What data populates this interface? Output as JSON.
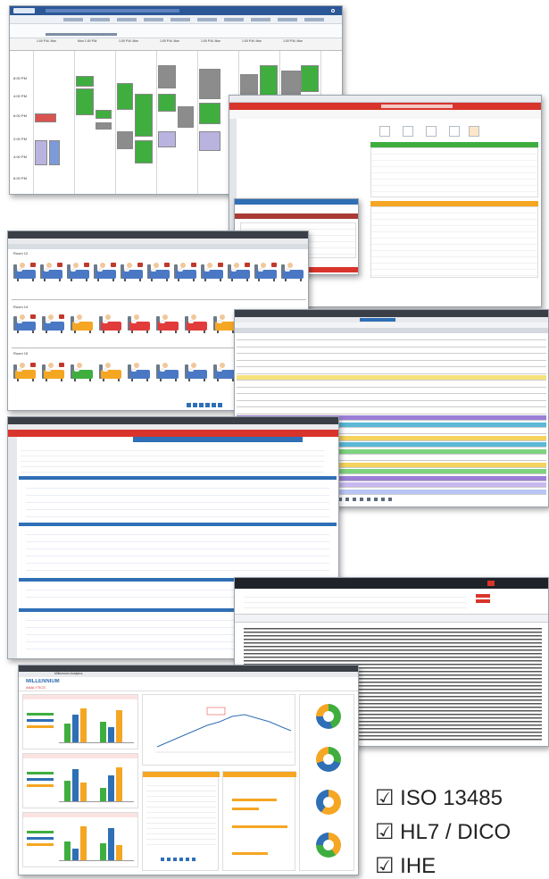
{
  "certifications": [
    "☑ ISO 13485",
    "☑ HL7 / DICO",
    "☑ IHE"
  ],
  "scheduler": {
    "day_headers": [
      "1:00 P.M. Mon",
      "Mon 1:00 P.M.",
      "1:00 P.M. Mon",
      "1:00 P.M. Mon",
      "1:00 P.M. Mon",
      "1:00 P.M. Mon",
      "1:00 P.M. Mon"
    ],
    "times": [
      "8:00 PM",
      "4:00 PM",
      "6:00 PM",
      "2:00 PM",
      "4:00 PM",
      "6:00 PM"
    ]
  },
  "bed_board": {
    "sections": [
      "Room 12",
      "Room 14",
      "Room 15"
    ]
  },
  "dashboard": {
    "app_name": "MILLENNIUM",
    "app_sub": "ANALYTICS",
    "tab": "Millennium Analytics"
  },
  "colors": {
    "green": "#3fae3f",
    "gray": "#8c8c8c",
    "lavender": "#b9b3e0",
    "blue": "#2f6fb5",
    "red": "#d9342b",
    "orange": "#f5a623"
  },
  "icons": {
    "check": "checkbox-icon",
    "bed": "hospital-bed-icon"
  }
}
